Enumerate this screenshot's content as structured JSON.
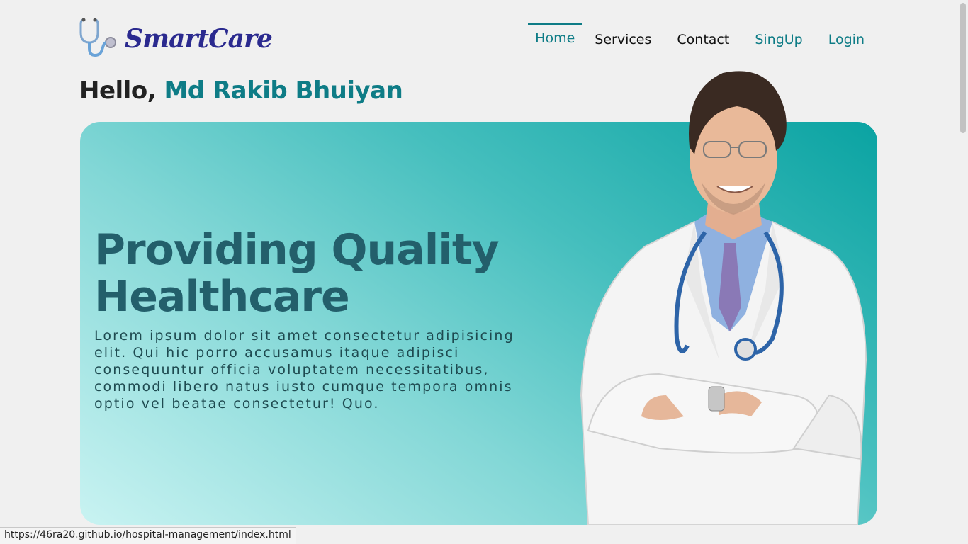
{
  "header": {
    "logo_text": "SmartCare",
    "nav": [
      {
        "label": "Home",
        "active": true
      },
      {
        "label": "Services",
        "active": false
      },
      {
        "label": "Contact",
        "active": false
      },
      {
        "label": "SingUp",
        "active": false
      },
      {
        "label": "Login",
        "active": false
      }
    ]
  },
  "greeting": {
    "prefix": "Hello,",
    "name": "Md Rakib Bhuiyan"
  },
  "hero": {
    "title_line1": "Providing Quality",
    "title_line2": "Healthcare",
    "description": "Lorem ipsum dolor sit amet consectetur adipisicing elit. Qui hic porro accusamus itaque adipisci consequuntur officia voluptatem necessitatibus, commodi libero natus iusto cumque tempora omnis optio vel beatae consectetur! Quo.",
    "image_icon": "doctor-illustration"
  },
  "colors": {
    "brand": "#0e7c86",
    "logo": "#2b2a8f",
    "hero_title": "#235f6b"
  },
  "status_bar": {
    "url": "https://46ra20.github.io/hospital-management/index.html"
  }
}
